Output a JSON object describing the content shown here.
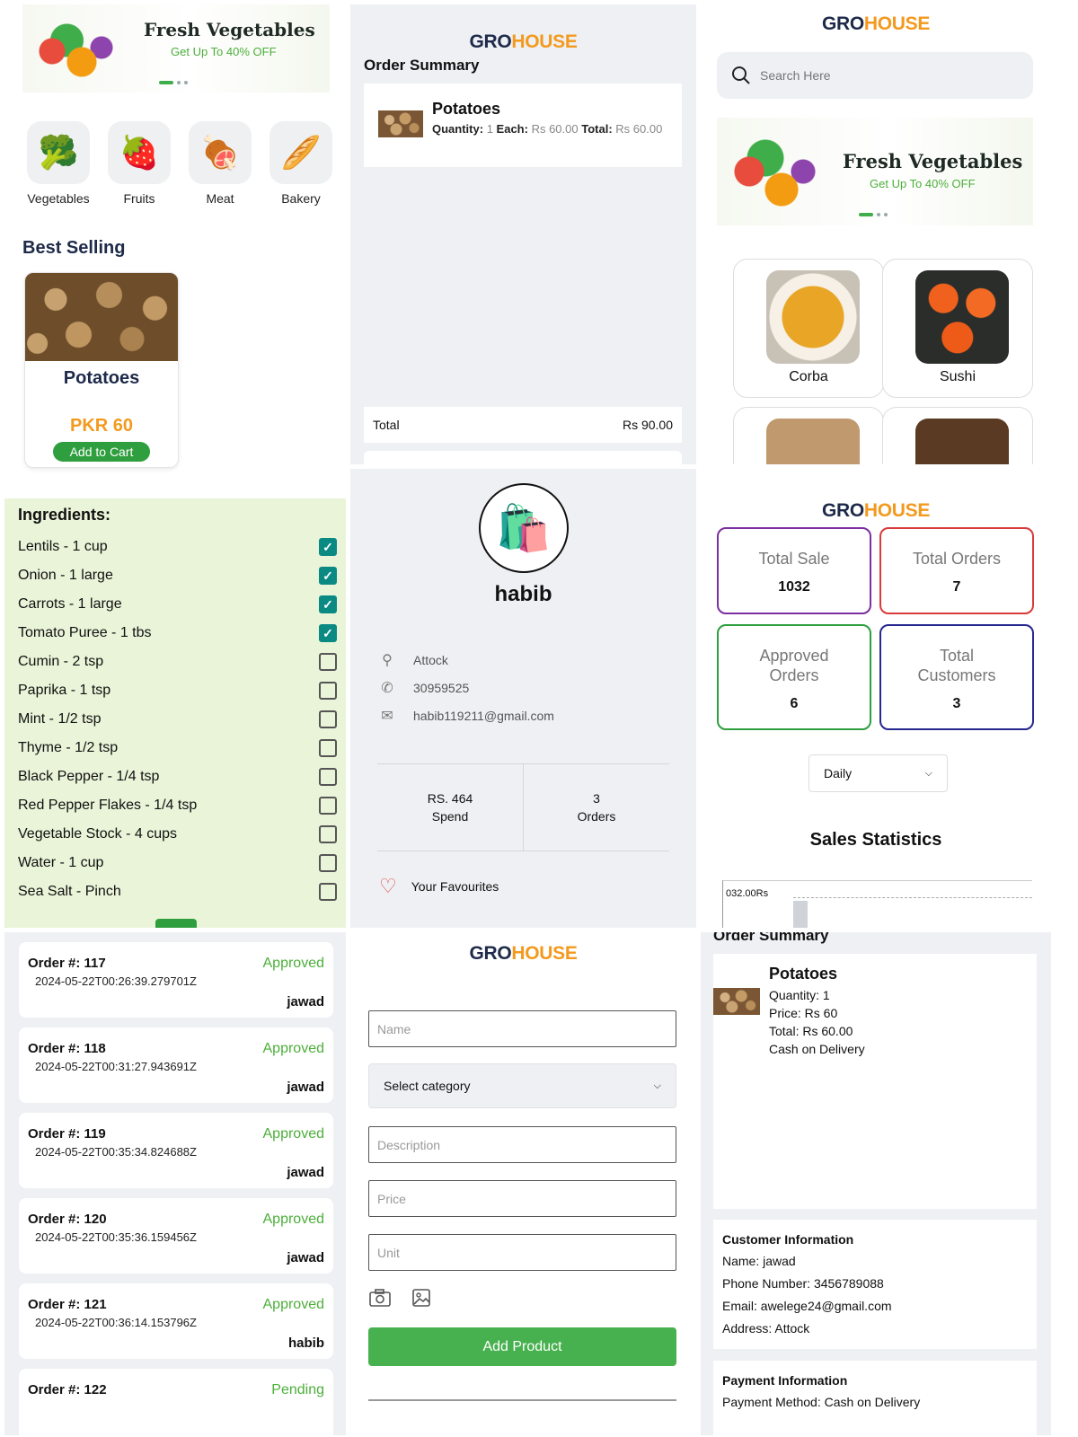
{
  "brand": {
    "part1": "GRO",
    "part2": "HOUSE"
  },
  "banner": {
    "title": "Fresh Vegetables",
    "subtitle": "Get Up To 40% OFF"
  },
  "home": {
    "categories": [
      {
        "label": "Vegetables",
        "icon": "vegetables-icon",
        "glyph": "🥦"
      },
      {
        "label": "Fruits",
        "icon": "strawberry-icon",
        "glyph": "🍓"
      },
      {
        "label": "Meat",
        "icon": "meat-icon",
        "glyph": "🍖"
      },
      {
        "label": "Bakery",
        "icon": "bread-icon",
        "glyph": "🥖"
      }
    ],
    "section_title": "Best Selling",
    "product": {
      "name": "Potatoes",
      "price": "PKR 60",
      "button": "Add to Cart"
    }
  },
  "order_summary": {
    "title": "Order Summary",
    "item": {
      "name": "Potatoes",
      "quantity_label": "Quantity:",
      "quantity": "1",
      "each_label": "Each:",
      "each": "Rs 60.00",
      "total_label": "Total:",
      "total": "Rs 60.00"
    },
    "total_label": "Total",
    "total_value": "Rs 90.00"
  },
  "search": {
    "placeholder": "Search Here",
    "foods": [
      {
        "label": "Corba"
      },
      {
        "label": "Sushi"
      }
    ]
  },
  "ingredients": {
    "title": "Ingredients:",
    "items": [
      {
        "label": "Lentils - 1 cup",
        "checked": true
      },
      {
        "label": "Onion - 1 large",
        "checked": true
      },
      {
        "label": "Carrots - 1 large",
        "checked": true
      },
      {
        "label": "Tomato Puree - 1 tbs",
        "checked": true
      },
      {
        "label": "Cumin - 2 tsp",
        "checked": false
      },
      {
        "label": "Paprika - 1 tsp",
        "checked": false
      },
      {
        "label": "Mint - 1/2 tsp",
        "checked": false
      },
      {
        "label": "Thyme - 1/2 tsp",
        "checked": false
      },
      {
        "label": "Black Pepper - 1/4 tsp",
        "checked": false
      },
      {
        "label": "Red Pepper Flakes - 1/4 tsp",
        "checked": false
      },
      {
        "label": "Vegetable Stock - 4 cups",
        "checked": false
      },
      {
        "label": "Water - 1 cup",
        "checked": false
      },
      {
        "label": "Sea Salt - Pinch",
        "checked": false
      }
    ]
  },
  "profile": {
    "name": "habib",
    "location": "Attock",
    "phone": "30959525",
    "email": "habib119211@gmail.com",
    "spend_value": "RS. 464",
    "spend_label": "Spend",
    "orders_value": "3",
    "orders_label": "Orders",
    "favourites": "Your Favourites"
  },
  "dashboard": {
    "stats": [
      {
        "label": "Total Sale",
        "value": "1032",
        "color": "#7b2fa0"
      },
      {
        "label": "Total Orders",
        "value": "7",
        "color": "#d93a3a"
      },
      {
        "label": "Approved Orders",
        "value": "6",
        "color": "#2e9e3e"
      },
      {
        "label": "Total Customers",
        "value": "3",
        "color": "#26278f"
      }
    ],
    "period": "Daily",
    "chart_title": "Sales Statistics",
    "chart_label": "032.00Rs"
  },
  "orders": [
    {
      "number": "Order #: 117",
      "date": "2024-05-22T00:26:39.279701Z",
      "status": "Approved",
      "user": "jawad"
    },
    {
      "number": "Order #: 118",
      "date": "2024-05-22T00:31:27.943691Z",
      "status": "Approved",
      "user": "jawad"
    },
    {
      "number": "Order #: 119",
      "date": "2024-05-22T00:35:34.824688Z",
      "status": "Approved",
      "user": "jawad"
    },
    {
      "number": "Order #: 120",
      "date": "2024-05-22T00:35:36.159456Z",
      "status": "Approved",
      "user": "jawad"
    },
    {
      "number": "Order #: 121",
      "date": "2024-05-22T00:36:14.153796Z",
      "status": "Approved",
      "user": "habib"
    },
    {
      "number": "Order #: 122",
      "date": "",
      "status": "Pending",
      "user": ""
    }
  ],
  "add_product": {
    "name_placeholder": "Name",
    "category": "Select category",
    "description_placeholder": "Description",
    "price_placeholder": "Price",
    "unit_placeholder": "Unit",
    "button": "Add Product"
  },
  "order_detail": {
    "title": "Order Summary",
    "name": "Potatoes",
    "quantity": "Quantity: 1",
    "price": "Price: Rs 60",
    "total": "Total: Rs 60.00",
    "method": "Cash on Delivery",
    "customer_title": "Customer Information",
    "customer_name": "Name: jawad",
    "customer_phone": "Phone Number: 3456789088",
    "customer_email": "Email: awelege24@gmail.com",
    "customer_address": "Address: Attock",
    "payment_title": "Payment Information",
    "payment_method": "Payment Method: Cash on Delivery"
  }
}
